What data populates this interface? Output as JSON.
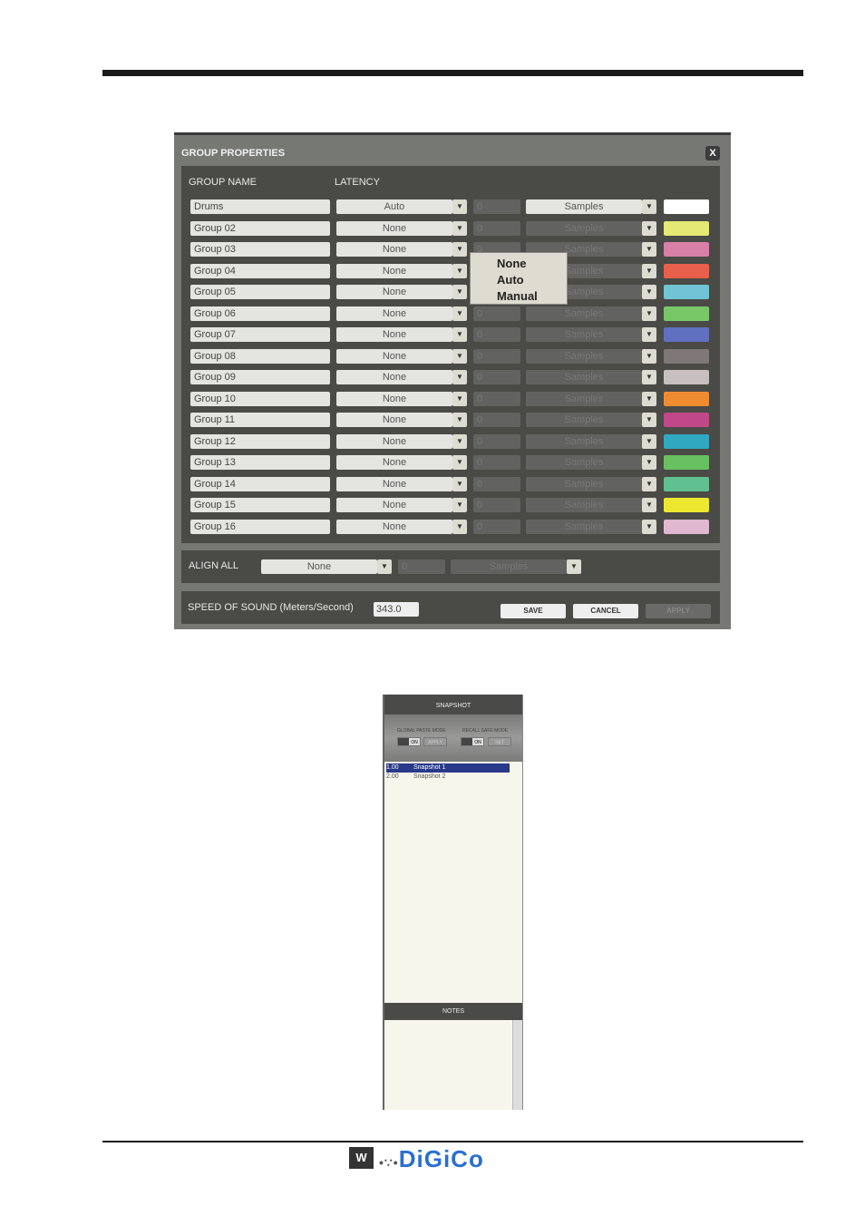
{
  "dialog": {
    "title": "GROUP PROPERTIES",
    "close": "X",
    "col_name": "GROUP NAME",
    "col_latency": "LATENCY",
    "groups": [
      {
        "name": "Drums",
        "latency": "Auto",
        "value": "0",
        "units": "Samples",
        "color": "#ffffff"
      },
      {
        "name": "Group 02",
        "latency": "None",
        "value": "0",
        "units": "Samples",
        "color": "#e4e874"
      },
      {
        "name": "Group 03",
        "latency": "None",
        "value": "0",
        "units": "Samples",
        "color": "#d880a8"
      },
      {
        "name": "Group 04",
        "latency": "None",
        "value": "0",
        "units": "Samples",
        "color": "#e8604c"
      },
      {
        "name": "Group 05",
        "latency": "None",
        "value": "0",
        "units": "Samples",
        "color": "#70c4d4"
      },
      {
        "name": "Group 06",
        "latency": "None",
        "value": "0",
        "units": "Samples",
        "color": "#78c868"
      },
      {
        "name": "Group 07",
        "latency": "None",
        "value": "0",
        "units": "Samples",
        "color": "#6070c0"
      },
      {
        "name": "Group 08",
        "latency": "None",
        "value": "0",
        "units": "Samples",
        "color": "#807878"
      },
      {
        "name": "Group 09",
        "latency": "None",
        "value": "0",
        "units": "Samples",
        "color": "#c8c0c0"
      },
      {
        "name": "Group 10",
        "latency": "None",
        "value": "0",
        "units": "Samples",
        "color": "#f08c30"
      },
      {
        "name": "Group 11",
        "latency": "None",
        "value": "0",
        "units": "Samples",
        "color": "#c04888"
      },
      {
        "name": "Group 12",
        "latency": "None",
        "value": "0",
        "units": "Samples",
        "color": "#30a8c0"
      },
      {
        "name": "Group 13",
        "latency": "None",
        "value": "0",
        "units": "Samples",
        "color": "#68c060"
      },
      {
        "name": "Group 14",
        "latency": "None",
        "value": "0",
        "units": "Samples",
        "color": "#60c090"
      },
      {
        "name": "Group 15",
        "latency": "None",
        "value": "0",
        "units": "Samples",
        "color": "#ece830"
      },
      {
        "name": "Group 16",
        "latency": "None",
        "value": "0",
        "units": "Samples",
        "color": "#e0b8d0"
      }
    ],
    "menu": [
      "None",
      "Auto",
      "Manual"
    ],
    "align_all": {
      "label": "ALIGN ALL",
      "latency": "None",
      "value": "0",
      "units": "Samples"
    },
    "speed": {
      "label": "SPEED OF SOUND (Meters/Second)",
      "value": "343.0"
    },
    "buttons": {
      "save": "SAVE",
      "cancel": "CANCEL",
      "apply": "APPLY"
    }
  },
  "snapshot": {
    "title": "SNAPSHOT",
    "global_paste": "GLOBAL PASTE MODE",
    "recall_safe": "RECALL SAFE MODE",
    "on": "ON",
    "apply": "APPLY",
    "set": "SET",
    "items": [
      {
        "num": "1.00",
        "name": "Snapshot 1"
      },
      {
        "num": "2.00",
        "name": "Snapshot 2"
      }
    ],
    "notes": "NOTES"
  },
  "footer": {
    "logo": "DiGiCo"
  }
}
